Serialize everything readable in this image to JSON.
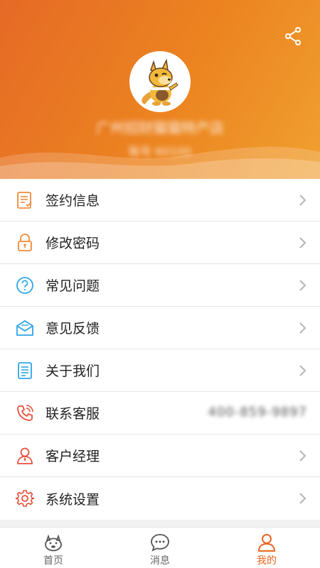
{
  "header": {
    "shop_name": "广州招财猫猫特产店",
    "account": "账号 60100",
    "share_icon": "share-icon",
    "avatar_icon": "kangaroo-mascot-avatar"
  },
  "menu": {
    "items": [
      {
        "label": "签约信息",
        "icon": "contract-icon",
        "color": "#f08a3a"
      },
      {
        "label": "修改密码",
        "icon": "lock-icon",
        "color": "#f08a3a"
      },
      {
        "label": "常见问题",
        "icon": "question-icon",
        "color": "#2ea6e6"
      },
      {
        "label": "意见反馈",
        "icon": "mail-icon",
        "color": "#2ea6e6"
      },
      {
        "label": "关于我们",
        "icon": "document-icon",
        "color": "#2ea6e6"
      },
      {
        "label": "联系客服",
        "icon": "phone-icon",
        "color": "#e8503a",
        "value": "400-859-9897"
      },
      {
        "label": "客户经理",
        "icon": "person-icon",
        "color": "#e8503a"
      },
      {
        "label": "系统设置",
        "icon": "gear-icon",
        "color": "#e8503a"
      }
    ]
  },
  "bottom_nav": {
    "items": [
      {
        "label": "首页",
        "icon": "home-kangaroo-icon"
      },
      {
        "label": "消息",
        "icon": "message-icon"
      },
      {
        "label": "我的",
        "icon": "profile-icon",
        "active": true
      }
    ]
  },
  "colors": {
    "accent": "#e8661f",
    "header_start": "#e56a26",
    "header_end": "#f0a030"
  }
}
